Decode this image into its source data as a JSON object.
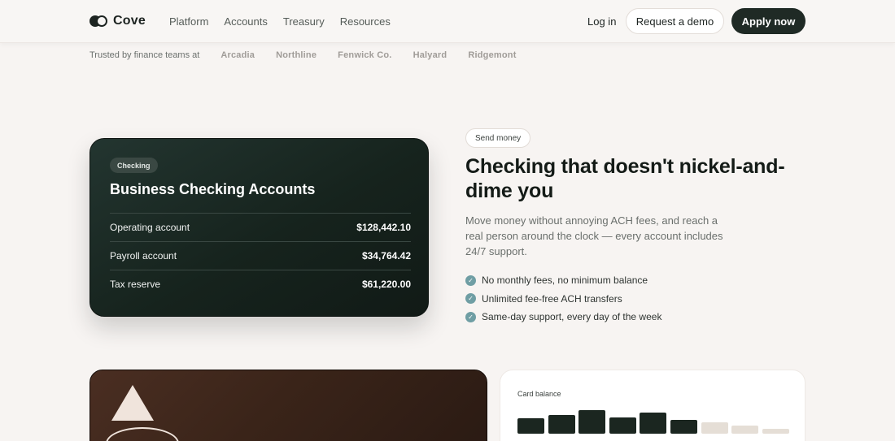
{
  "brand": {
    "name": "Cove"
  },
  "nav": {
    "items": [
      "Platform",
      "Accounts",
      "Treasury",
      "Resources"
    ]
  },
  "header_actions": {
    "login": "Log in",
    "demo": "Request a demo",
    "apply": "Apply now"
  },
  "trusted": {
    "label": "Trusted by finance teams at",
    "logos": [
      "Arcadia",
      "Northline",
      "Fenwick Co.",
      "Halyard",
      "Ridgemont"
    ]
  },
  "checking_card": {
    "badge": "Checking",
    "title": "Business Checking Accounts",
    "rows": [
      {
        "name": "Operating account",
        "amount": "$128,442.10"
      },
      {
        "name": "Payroll account",
        "amount": "$34,764.42"
      },
      {
        "name": "Tax reserve",
        "amount": "$61,220.00"
      }
    ]
  },
  "feature": {
    "pill": "Send money",
    "headline": "Checking that doesn't nickel-and-dime you",
    "body": "Move money without annoying ACH fees, and reach a real person around the clock — every account includes 24/7 support.",
    "bullets": [
      "No monthly fees, no minimum balance",
      "Unlimited fee-free ACH transfers",
      "Same-day support, every day of the week"
    ]
  },
  "balance_card": {
    "title": "Card balance",
    "bars": [
      {
        "value": 0.62,
        "active": true
      },
      {
        "value": 0.78,
        "active": true
      },
      {
        "value": 0.95,
        "active": true
      },
      {
        "value": 0.68,
        "active": true
      },
      {
        "value": 0.85,
        "active": true
      },
      {
        "value": 0.58,
        "active": true
      },
      {
        "value": 0.45,
        "active": false
      },
      {
        "value": 0.32,
        "active": false
      },
      {
        "value": 0.2,
        "active": false
      }
    ]
  },
  "colors": {
    "accent_dark": "#1f2a25",
    "check": "#6f9ea4",
    "bar_active": "#1b2620",
    "bar_inactive": "#e5ded6"
  },
  "icons": {
    "check": "check-icon",
    "triangle": "triangle-icon",
    "ring": "ring-icon"
  }
}
